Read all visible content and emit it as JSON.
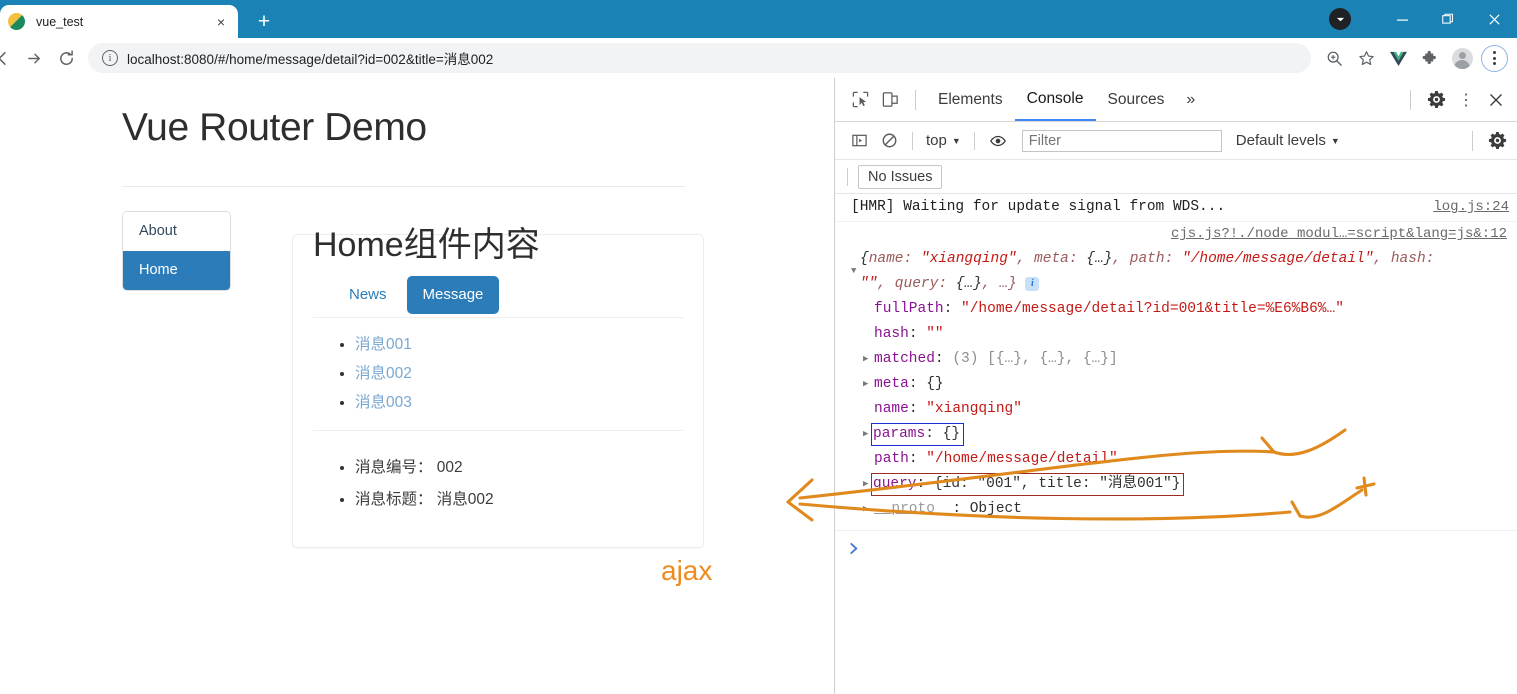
{
  "browser": {
    "tab": {
      "title": "vue_test",
      "close_label": "×",
      "favicon": "vue-favicon"
    },
    "new_tab_label": "+",
    "window_controls": {
      "minimize": "—",
      "maximize": "❐",
      "close": "✕"
    },
    "toolbar": {
      "back_label": "←",
      "forward_label": "→",
      "reload_label": "↻",
      "info_label": "i",
      "url": "localhost:8080/#/home/message/detail?id=002&title=消息002",
      "url_host": "localhost",
      "url_rest": ":8080/#/home/message/detail?id=002&title=消息002",
      "zoom_icon_label": "⊕",
      "bookmark_icon_label": "☆",
      "vue_devtools_label": "V",
      "extensions_label": "❖",
      "profile_label": "profile",
      "menu_label": "⋮"
    }
  },
  "page": {
    "title": "Vue Router Demo",
    "nav": [
      {
        "label": "About",
        "active": false
      },
      {
        "label": "Home",
        "active": true
      }
    ],
    "component_heading": "Home组件内容",
    "pills": [
      {
        "label": "News",
        "active": false
      },
      {
        "label": "Message",
        "active": true
      }
    ],
    "messages": [
      {
        "label": "消息001"
      },
      {
        "label": "消息002"
      },
      {
        "label": "消息003"
      }
    ],
    "detail": [
      {
        "label": "消息编号： 002"
      },
      {
        "label": "消息标题： 消息002"
      }
    ]
  },
  "annotation": {
    "ajax_label": "ajax",
    "ajax_color": "#ef8a1e"
  },
  "devtools": {
    "inspect_icon": "inspect-cursor-icon",
    "device_icon": "device-toolbar-icon",
    "tabs": [
      {
        "label": "Elements",
        "active": false
      },
      {
        "label": "Console",
        "active": true
      },
      {
        "label": "Sources",
        "active": false
      }
    ],
    "more_tabs_label": "»",
    "settings_label": "gear-icon",
    "kebab_label": "⋮",
    "close_label": "✕",
    "filterbar": {
      "sidebar_toggle": "console-sidebar-icon",
      "clear_label": "⊘",
      "context": "top",
      "context_caret": "▼",
      "eye_label": "live-expression-icon",
      "filter_placeholder": "Filter",
      "filter_value": "",
      "levels": "Default levels",
      "levels_caret": "▼",
      "settings_label": "gear-icon"
    },
    "issues": {
      "label": "No Issues"
    },
    "console": {
      "hmr_message": "[HMR] Waiting for update signal from WDS...",
      "hmr_source": "log.js:24",
      "object_source": "cjs.js?!./node_modul…=script&lang=js&:12",
      "preview": {
        "open": "{",
        "name_key": "name: ",
        "name_val": "\"xiangqing\"",
        "meta_key": ", meta: ",
        "meta_val": "{…}",
        "path_key": ", path: ",
        "path_val": "\"/home/message/detail\"",
        "hash_key": ", hash: ",
        "hash_val": "\"\"",
        "query_key": ", query: ",
        "query_val": "{…}",
        "tail": ", …}",
        "full_text": "{name: \"xiangqing\", meta: {…}, path: \"/home/message/detail\", hash: \"\", query: {…}, …}"
      },
      "properties": [
        {
          "key": "fullPath",
          "value": "\"/home/message/detail?id=001&title=%E6%B6%…\"",
          "expandable": false,
          "type": "string",
          "highlight": "none"
        },
        {
          "key": "hash",
          "value": "\"\"",
          "expandable": false,
          "type": "string",
          "highlight": "none"
        },
        {
          "key": "matched",
          "value": "(3) [{…}, {…}, {…}]",
          "expandable": true,
          "type": "array",
          "highlight": "none"
        },
        {
          "key": "meta",
          "value": "{}",
          "expandable": true,
          "type": "object",
          "highlight": "none"
        },
        {
          "key": "name",
          "value": "\"xiangqing\"",
          "expandable": false,
          "type": "string",
          "highlight": "none"
        },
        {
          "key": "params",
          "value": "{}",
          "expandable": true,
          "type": "object",
          "highlight": "blue"
        },
        {
          "key": "path",
          "value": "\"/home/message/detail\"",
          "expandable": false,
          "type": "string",
          "highlight": "none"
        },
        {
          "key": "query",
          "value": "{id: \"001\", title: \"消息001\"}",
          "expandable": true,
          "type": "object",
          "highlight": "red"
        },
        {
          "key": "__proto__",
          "value": "Object",
          "expandable": true,
          "type": "proto",
          "highlight": "none"
        }
      ],
      "prompt": "❯"
    }
  },
  "colors": {
    "accent_blue": "#2b7cb9",
    "browser_chrome": "#1b82b6",
    "annotation_orange": "#ef8a1e",
    "box_blue": "#1a2ed6",
    "box_red": "#9e2b20",
    "devtools_tab_underline": "#4285f4"
  }
}
